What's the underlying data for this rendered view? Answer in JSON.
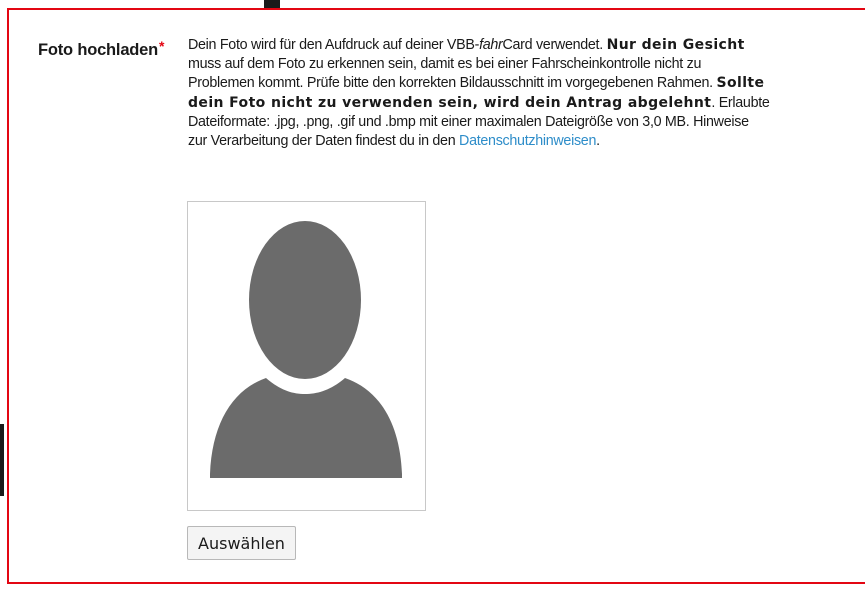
{
  "upload": {
    "label": "Foto hochladen",
    "required_marker": "*",
    "description": {
      "l1_a": "Dein Foto wird für den Aufdruck auf deiner VBB-",
      "l1_b": "fahr",
      "l1_c": "Card verwendet. ",
      "l1_bold": "Nur dein Gesicht",
      "l2": "muss auf dem Foto zu erkennen sein, damit es bei einer Fahrscheinkontrolle nicht zu",
      "l3_a": "Problemen kommt. Prüfe bitte den korrekten Bildausschnitt im vorgegebenen Rahmen. ",
      "l3_bold": "Sollte",
      "l4_bold": "dein Foto nicht zu verwenden sein, wird dein Antrag abgelehnt",
      "l4_c": ". Erlaubte",
      "l5": "Dateiformate: .jpg, .png, .gif und .bmp mit einer maximalen Dateigröße von 3,0 MB. Hinweise",
      "l6_a": "zur Verarbeitung der Daten findest du in den ",
      "l6_link": "Datenschutzhinweisen",
      "l6_c": "."
    },
    "photo_placeholder_icon": "person-silhouette-icon",
    "choose_button_label": "Auswählen"
  },
  "colors": {
    "accent_red": "#e30613",
    "link_blue": "#2e8dc9",
    "silhouette_gray": "#6b6b6b",
    "text": "#1a1a1a"
  }
}
